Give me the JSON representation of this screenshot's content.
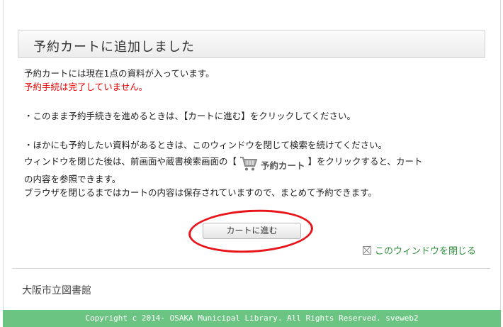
{
  "dialog": {
    "title": "予約カートに追加しました",
    "status_line": "予約カートには現在1点の資料が入っています。",
    "warning_line": "予約手続は完了していません。",
    "instruction_proceed": "・このまま予約手続きを進めるときは、【カートに進む】をクリックしてください。",
    "instruction_close_1": "・ほかにも予約したい資料があるときは、このウィンドウを閉じて検索を続けてください。",
    "instruction_close_2_before": "ウィンドウを閉じた後は、前画面や蔵書検索画面の【",
    "cart_label": "予約カート",
    "instruction_close_2_after": "】をクリックすると、カート",
    "instruction_close_3": "の内容を参照できます。",
    "instruction_close_4": "ブラウザを閉じるまではカートの内容は保存されていますので、まとめて予約できます。",
    "proceed_button": "カートに進む",
    "close_window_link": "このウィンドウを閉じる"
  },
  "library_name": "大阪市立図書館",
  "footer": {
    "copyright": "Copyright c 2014- OSAKA Municipal Library. All Rights Reserved. sveweb2"
  },
  "colors": {
    "warning": "#e00000",
    "link_green": "#2f8e3b",
    "footer_bg": "#6bc481",
    "annotation_red": "#e8141a"
  },
  "icons": [
    "shopping-cart-icon",
    "close-box-icon"
  ]
}
